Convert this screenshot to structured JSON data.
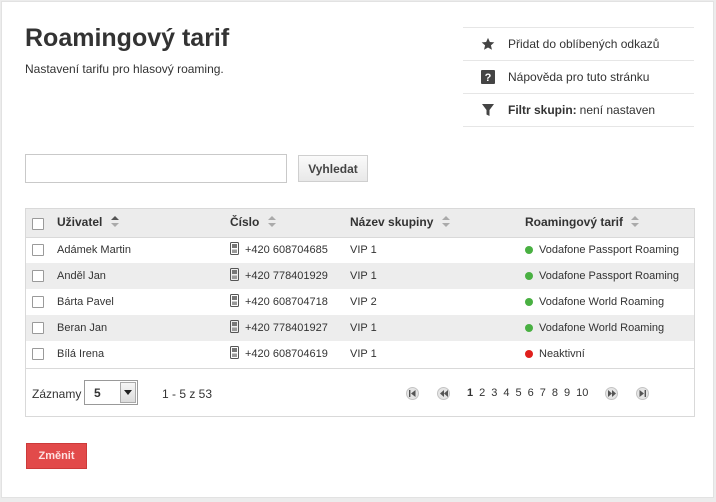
{
  "page": {
    "title": "Roamingový tarif",
    "subtitle": "Nastavení tarifu pro hlasový roaming."
  },
  "side_links": {
    "favorites": "Přidat do oblíbených odkazů",
    "help": "Nápověda pro tuto stránku",
    "filter_label": "Filtr skupin:",
    "filter_value": "není nastaven"
  },
  "search": {
    "value": "",
    "placeholder": "",
    "button_label": "Vyhledat"
  },
  "table": {
    "headers": {
      "user": "Uživatel",
      "number": "Číslo",
      "group": "Název skupiny",
      "tariff": "Roamingový tarif"
    },
    "rows": [
      {
        "user": "Adámek Martin",
        "number": "+420 608704685",
        "group": "VIP 1",
        "tariff": "Vodafone Passport Roaming",
        "status_color": "#49b042"
      },
      {
        "user": "Anděl Jan",
        "number": "+420 778401929",
        "group": "VIP 1",
        "tariff": "Vodafone Passport Roaming",
        "status_color": "#49b042"
      },
      {
        "user": "Bárta Pavel",
        "number": "+420 608704718",
        "group": "VIP 2",
        "tariff": "Vodafone World Roaming",
        "status_color": "#49b042"
      },
      {
        "user": "Beran Jan",
        "number": "+420 778401927",
        "group": "VIP 1",
        "tariff": "Vodafone World Roaming",
        "status_color": "#49b042"
      },
      {
        "user": "Bílá Irena",
        "number": "+420 608704619",
        "group": "VIP 1",
        "tariff": "Neaktivní",
        "status_color": "#e0201c"
      }
    ]
  },
  "pagination": {
    "records_label": "Záznamy",
    "page_size": "5",
    "range": "1 - 5 z 53",
    "pages": [
      "1",
      "2",
      "3",
      "4",
      "5",
      "6",
      "7",
      "8",
      "9",
      "10"
    ],
    "current_page": "1"
  },
  "actions": {
    "change_label": "Změnit"
  },
  "colors": {
    "accent_red": "#e24a4a",
    "active_green": "#49b042",
    "inactive_red": "#e0201c"
  },
  "icons": {
    "favorites": "star-icon",
    "help": "question-icon",
    "filter": "filter-icon",
    "phone": "phone-icon",
    "sort": "sort-icon"
  }
}
